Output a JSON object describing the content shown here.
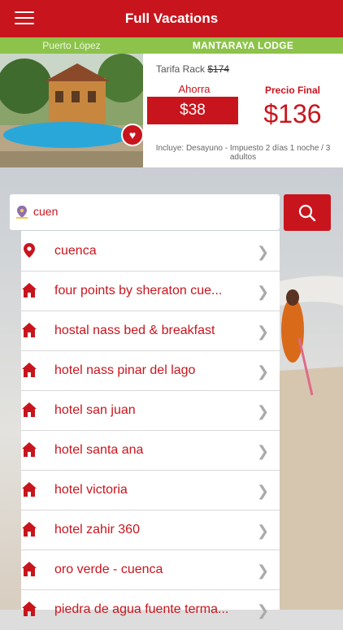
{
  "header": {
    "title": "Full Vacations",
    "menu_icon": "hamburger-icon",
    "color": "#c8151d"
  },
  "deal": {
    "location": "Puerto López",
    "name": "MANTARAYA LODGE",
    "tarifa_label": "Tarifa Rack",
    "tarifa_value": "$174",
    "ahorra_label": "Ahorra",
    "ahorra_value": "$38",
    "precio_label": "Precio Final",
    "precio_value": "$136",
    "incluye": "Incluye: Desayuno - Impuesto 2 días 1 noche / 3 adultos",
    "green": "#8dc34a"
  },
  "search": {
    "value": "cuen",
    "icon": "search-icon"
  },
  "results": [
    {
      "label": "cuenca",
      "icon": "location-pin-icon"
    },
    {
      "label": "four points by sheraton cue...",
      "icon": "house-icon"
    },
    {
      "label": "hostal nass bed & breakfast",
      "icon": "house-icon"
    },
    {
      "label": "hotel nass pinar del lago",
      "icon": "house-icon"
    },
    {
      "label": "hotel san juan",
      "icon": "house-icon"
    },
    {
      "label": "hotel santa ana",
      "icon": "house-icon"
    },
    {
      "label": "hotel victoria",
      "icon": "house-icon"
    },
    {
      "label": "hotel zahir 360",
      "icon": "house-icon"
    },
    {
      "label": "oro verde - cuenca",
      "icon": "house-icon"
    },
    {
      "label": "piedra de agua fuente terma...",
      "icon": "house-icon"
    }
  ]
}
